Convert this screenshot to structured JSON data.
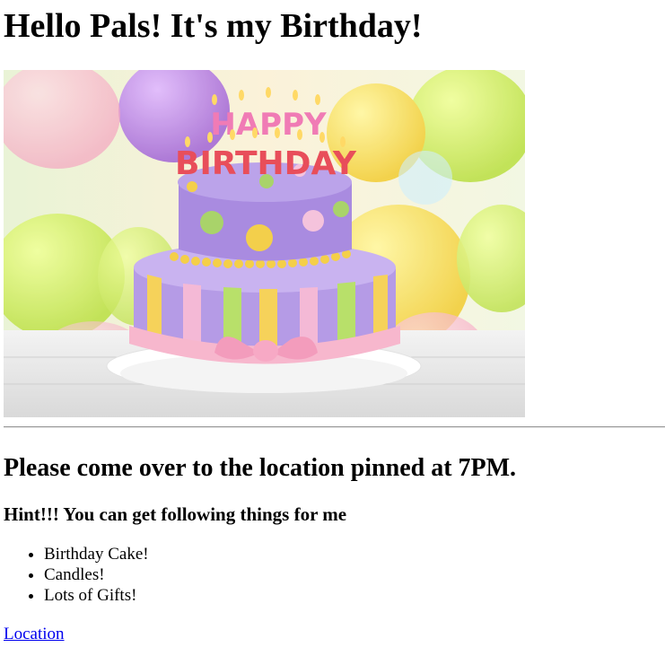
{
  "heading": "Hello Pals! It's my Birthday!",
  "image": {
    "alt": "Birthday cake with Happy Birthday candles",
    "cake_topper_line1": "HAPPY",
    "cake_topper_line2": "BIRTHDAY"
  },
  "invite_text": "Please come over to the location pinned at 7PM.",
  "hint_text": "Hint!!! You can get following things for me",
  "gift_list": [
    "Birthday Cake!",
    "Candles!",
    "Lots of Gifts!"
  ],
  "location_link": "Location"
}
